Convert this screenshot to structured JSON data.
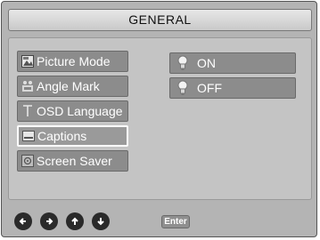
{
  "title": "GENERAL",
  "menu": {
    "items": [
      {
        "label": "Picture Mode",
        "icon": "picture-mode-icon"
      },
      {
        "label": "Angle Mark",
        "icon": "angle-mark-icon"
      },
      {
        "label": "OSD Language",
        "icon": "osd-language-icon"
      },
      {
        "label": "Captions",
        "icon": "captions-icon",
        "selected": true
      },
      {
        "label": "Screen Saver",
        "icon": "screen-saver-icon"
      }
    ]
  },
  "options": {
    "items": [
      {
        "label": "ON",
        "icon": "bulb-icon"
      },
      {
        "label": "OFF",
        "icon": "bulb-icon"
      }
    ]
  },
  "footer": {
    "nav_icons": [
      "left-arrow-icon",
      "right-arrow-icon",
      "up-arrow-icon",
      "down-arrow-icon"
    ],
    "enter_label": "Enter"
  },
  "colors": {
    "panel": "#b4b4b4",
    "item": "#8c8c8c",
    "selected_border": "#ffffff",
    "text": "#ffffff"
  }
}
